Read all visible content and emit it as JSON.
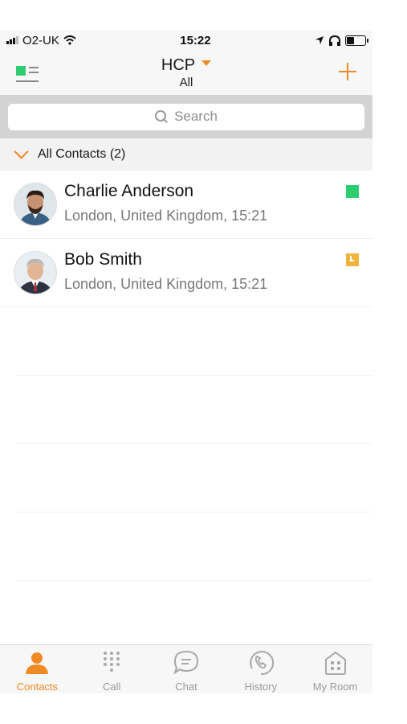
{
  "status_bar": {
    "carrier": "O2-UK",
    "time": "15:22"
  },
  "nav": {
    "title": "HCP",
    "subtitle": "All"
  },
  "search": {
    "placeholder": "Search"
  },
  "section": {
    "label": "All Contacts (2)"
  },
  "contacts": [
    {
      "name": "Charlie Anderson",
      "location": "London, United Kingdom, 15:21",
      "status": "available",
      "status_color": "#2ecc71"
    },
    {
      "name": "Bob Smith",
      "location": "London, United Kingdom, 15:21",
      "status": "away",
      "status_color": "#f0b43c"
    }
  ],
  "tabs": [
    {
      "label": "Contacts",
      "icon": "person-icon",
      "active": true
    },
    {
      "label": "Call",
      "icon": "dialpad-icon",
      "active": false
    },
    {
      "label": "Chat",
      "icon": "chat-bubble-icon",
      "active": false
    },
    {
      "label": "History",
      "icon": "history-phone-icon",
      "active": false
    },
    {
      "label": "My Room",
      "icon": "room-icon",
      "active": false
    }
  ],
  "colors": {
    "accent": "#f08a24",
    "available": "#2ecc71",
    "away": "#f0b43c"
  }
}
